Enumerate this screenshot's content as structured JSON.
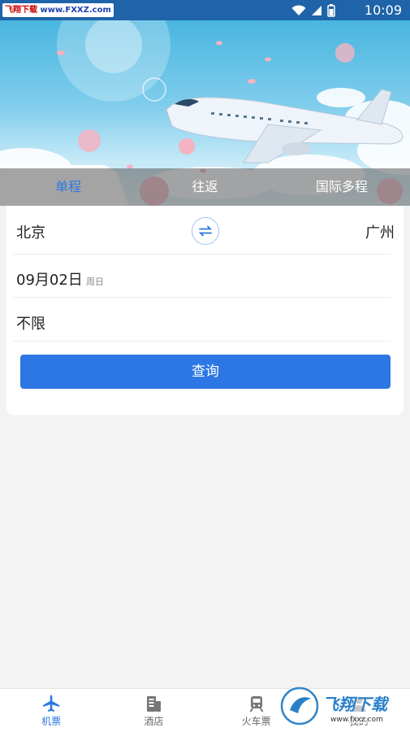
{
  "status_bar": {
    "watermark_site": "飞翔下载",
    "watermark_url": "www.FXXZ.com",
    "time": "10:09"
  },
  "trip_tabs": [
    {
      "label": "单程",
      "active": true
    },
    {
      "label": "往返",
      "active": false
    },
    {
      "label": "国际多程",
      "active": false
    }
  ],
  "route": {
    "from": "北京",
    "to": "广州"
  },
  "date": {
    "value": "09月02日",
    "weekday": "周日"
  },
  "cabin": {
    "value": "不限"
  },
  "search_button": {
    "label": "查询"
  },
  "bottom_nav": [
    {
      "label": "机票",
      "icon": "airplane-icon",
      "active": true
    },
    {
      "label": "酒店",
      "icon": "hotel-icon",
      "active": false
    },
    {
      "label": "火车票",
      "icon": "train-icon",
      "active": false
    },
    {
      "label": "我的",
      "icon": "user-icon",
      "active": false
    }
  ],
  "colors": {
    "accent": "#2c77e4",
    "statusbar": "#1f63a8"
  },
  "corner_watermark": {
    "text": "飞翔下载",
    "url": "www.fxxz.com"
  }
}
